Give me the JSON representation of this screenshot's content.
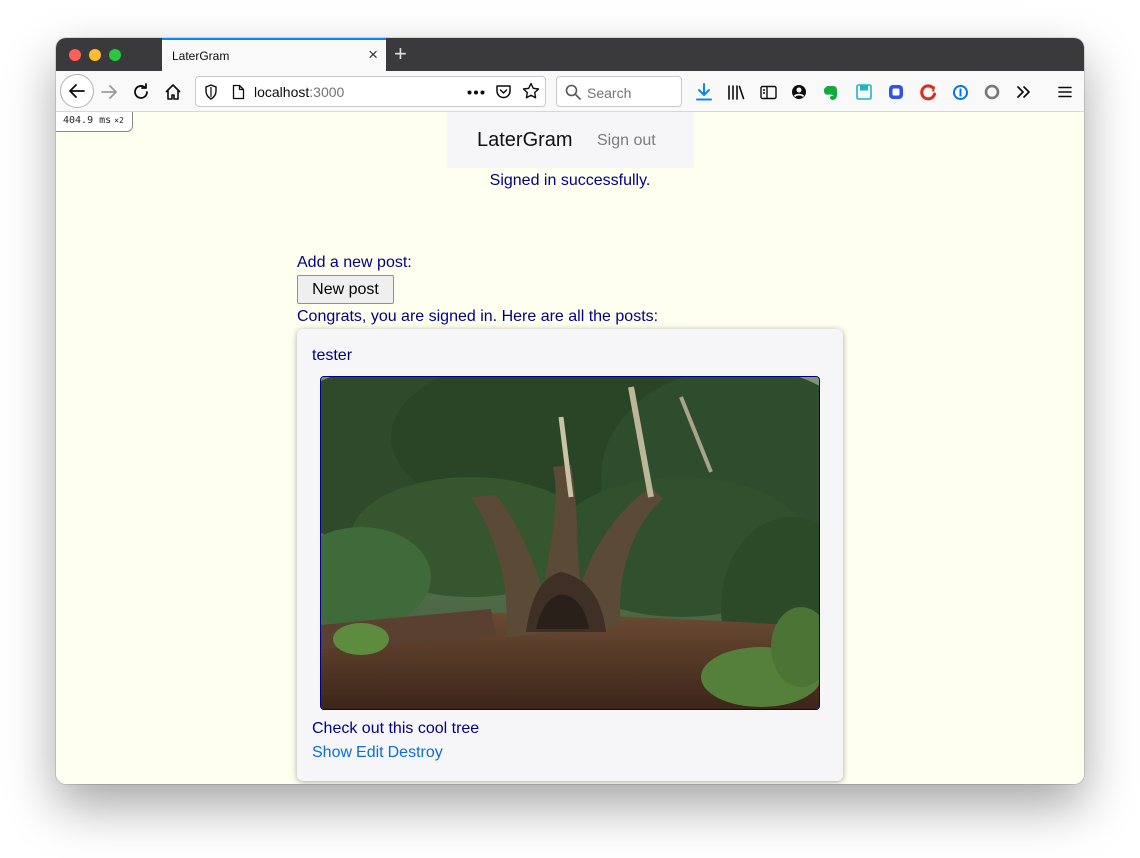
{
  "browser": {
    "tab_title": "LaterGram",
    "url_host": "localhost",
    "url_port": ":3000",
    "search_placeholder": "Search",
    "tab_close": "×",
    "new_tab": "+"
  },
  "perf_badge": {
    "time": "404.9 ms",
    "multiplier": "×2"
  },
  "navbar": {
    "brand": "LaterGram",
    "sign_out": "Sign out"
  },
  "flash": "Signed in successfully.",
  "main": {
    "add_label": "Add a new post:",
    "new_post_button": "New post",
    "congrats": "Congrats, you are signed in. Here are all the posts:"
  },
  "posts": [
    {
      "author": "tester",
      "caption": "Check out this cool tree",
      "actions": {
        "show": "Show",
        "edit": "Edit",
        "destroy": "Destroy"
      }
    }
  ],
  "colors": {
    "page_bg": "#fffff0",
    "text": "#00008b",
    "link": "#0a6ee4",
    "tab_accent": "#0a84ff"
  }
}
